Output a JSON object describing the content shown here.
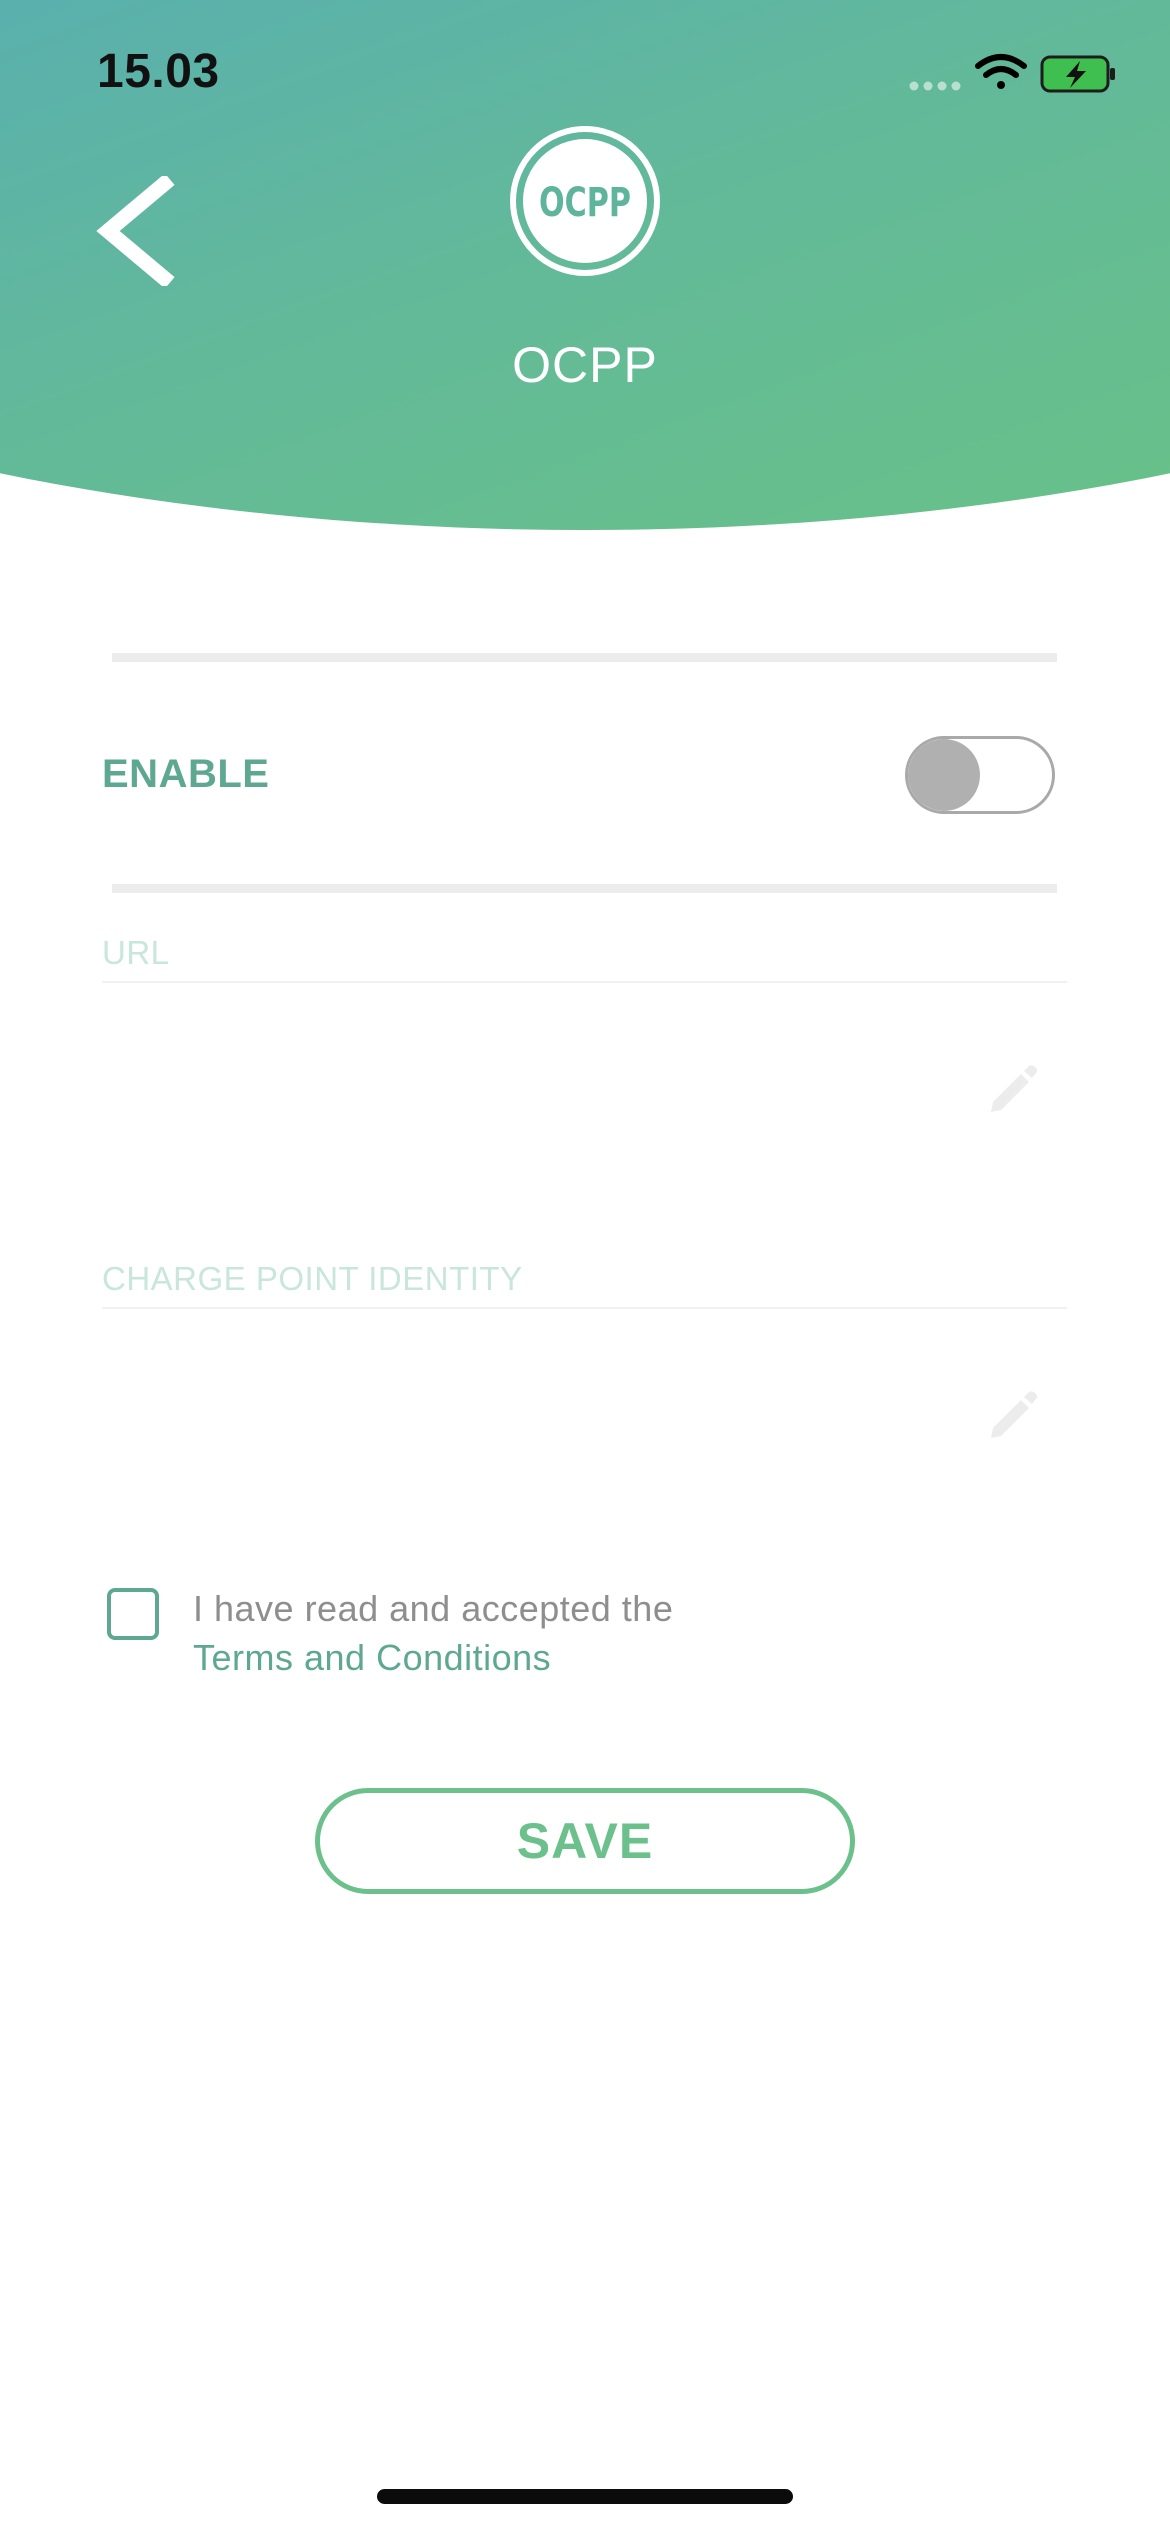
{
  "status_bar": {
    "time": "15.03",
    "icons": [
      "cellular-signal-icon",
      "wifi-icon",
      "battery-charging-icon"
    ],
    "battery_color": "#3fbf4f"
  },
  "header": {
    "back_icon": "chevron-left-icon",
    "logo_text": "OCPP",
    "title": "OCPP",
    "gradient_colors": [
      "#5ab0ad",
      "#68c188"
    ]
  },
  "settings": {
    "enable_label": "ENABLE",
    "enable_on": false
  },
  "fields": {
    "url": {
      "label": "URL",
      "value": "",
      "placeholder": "",
      "icon": "pencil-icon"
    },
    "charge_point_identity": {
      "label": "CHARGE POINT IDENTITY",
      "value": "",
      "placeholder": "",
      "icon": "pencil-icon"
    }
  },
  "consent": {
    "checked": false,
    "text": "I have read and accepted the",
    "link_text": "Terms and Conditions"
  },
  "actions": {
    "save_label": "SAVE"
  },
  "colors": {
    "accent": "#5ea892",
    "button": "#6cc08b",
    "field_label": "#c9e6dc"
  }
}
